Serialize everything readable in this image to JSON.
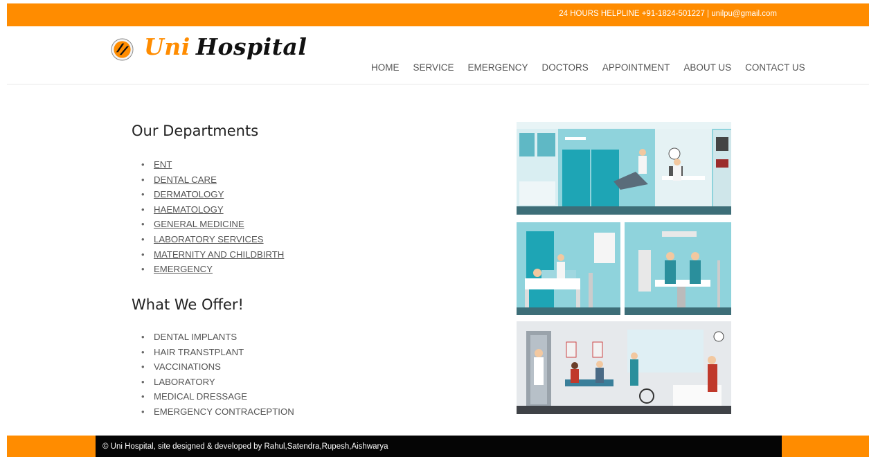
{
  "topbar": {
    "helpline": "24 HOURS HELPLINE +91-1824-501227 | unilpu@gmail.com"
  },
  "brand": {
    "word1": "Uni",
    "word2": "Hospital"
  },
  "nav": [
    "HOME",
    "SERVICE",
    "EMERGENCY",
    "DOCTORS",
    "APPOINTMENT",
    "ABOUT US",
    "CONTACT US"
  ],
  "departments": {
    "title": "Our Departments",
    "items": [
      "ENT",
      "DENTAL CARE",
      "DERMATOLOGY",
      "HAEMATOLOGY",
      "GENERAL MEDICINE",
      "LABORATORY SERVICES",
      "MATERNITY AND CHILDBIRTH",
      "EMERGENCY"
    ]
  },
  "offer": {
    "title": "What We Offer!",
    "items": [
      "DENTAL IMPLANTS",
      "HAIR TRANSTPLANT",
      "VACCINATIONS",
      "LABORATORY",
      "MEDICAL DRESSAGE",
      "EMERGENCY CONTRACEPTION"
    ]
  },
  "footer": {
    "text": "© Uni Hospital, site designed & developed by Rahul,Satendra,Rupesh,Aishwarya"
  },
  "colors": {
    "accent": "#ff8c00",
    "footer": "#050505",
    "teal": "#4fc3cf"
  }
}
